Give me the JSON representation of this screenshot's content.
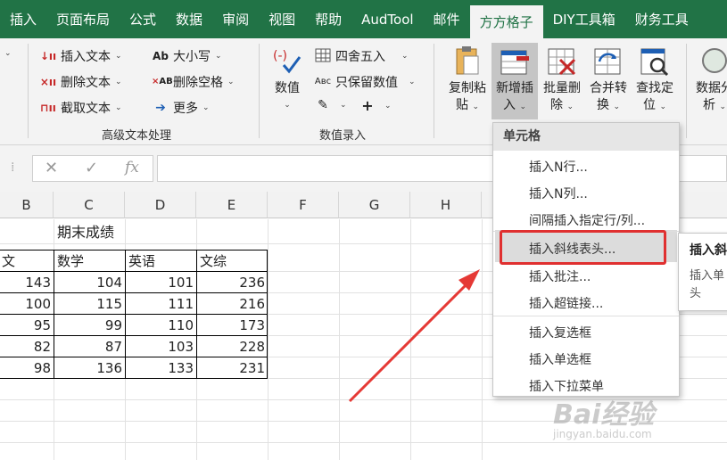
{
  "tabs": [
    "插入",
    "页面布局",
    "公式",
    "数据",
    "审阅",
    "视图",
    "帮助",
    "AudTool",
    "邮件",
    "方方格子",
    "DIY工具箱",
    "财务工具"
  ],
  "active_tab_index": 9,
  "ribbon": {
    "text_group": {
      "label": "高级文本处理",
      "insert_text": "插入文本",
      "delete_text": "删除文本",
      "cut_text": "截取文本",
      "case": "大小写",
      "delete_space": "删除空格",
      "more": "更多",
      "case_icon": "Ab",
      "delete_space_icon": "AB"
    },
    "value_group": {
      "label": "数值录入",
      "value_btn": "数值",
      "round": "四舍五入",
      "keep_value": "只保留数值",
      "keep_icon": "Aвс"
    },
    "big_buttons": [
      {
        "line1": "复制粘",
        "line2": "贴"
      },
      {
        "line1": "新增插",
        "line2": "入"
      },
      {
        "line1": "批量删",
        "line2": "除"
      },
      {
        "line1": "合并转",
        "line2": "换"
      },
      {
        "line1": "查找定",
        "line2": "位"
      },
      {
        "line1": "数据分",
        "line2": "析"
      }
    ]
  },
  "formula_bar": {
    "cancel": "✕",
    "confirm": "✓",
    "fx": "fx"
  },
  "columns": [
    "B",
    "C",
    "D",
    "E",
    "F",
    "G",
    "H"
  ],
  "sheet": {
    "title": "期末成绩",
    "headers": [
      "文",
      "数学",
      "英语",
      "文综"
    ],
    "rows": [
      [
        "143",
        "104",
        "101",
        "236"
      ],
      [
        "100",
        "115",
        "111",
        "216"
      ],
      [
        "95",
        "99",
        "110",
        "173"
      ],
      [
        "82",
        "87",
        "103",
        "228"
      ],
      [
        "98",
        "136",
        "133",
        "231"
      ]
    ]
  },
  "menu": {
    "header": "单元格",
    "items": [
      "插入N行...",
      "插入N列...",
      "间隔插入指定行/列...",
      "插入斜线表头...",
      "插入批注...",
      "插入超链接...",
      "插入复选框",
      "插入单选框",
      "插入下拉菜单"
    ],
    "highlighted_index": 3
  },
  "tooltip": {
    "title": "插入斜",
    "body": "插入单头"
  },
  "watermark": {
    "main": "Bai经验",
    "sub": "jingyan.baidu.com"
  },
  "colors": {
    "accent": "#217346",
    "highlight_border": "#e03030",
    "arrow": "#e53935"
  }
}
